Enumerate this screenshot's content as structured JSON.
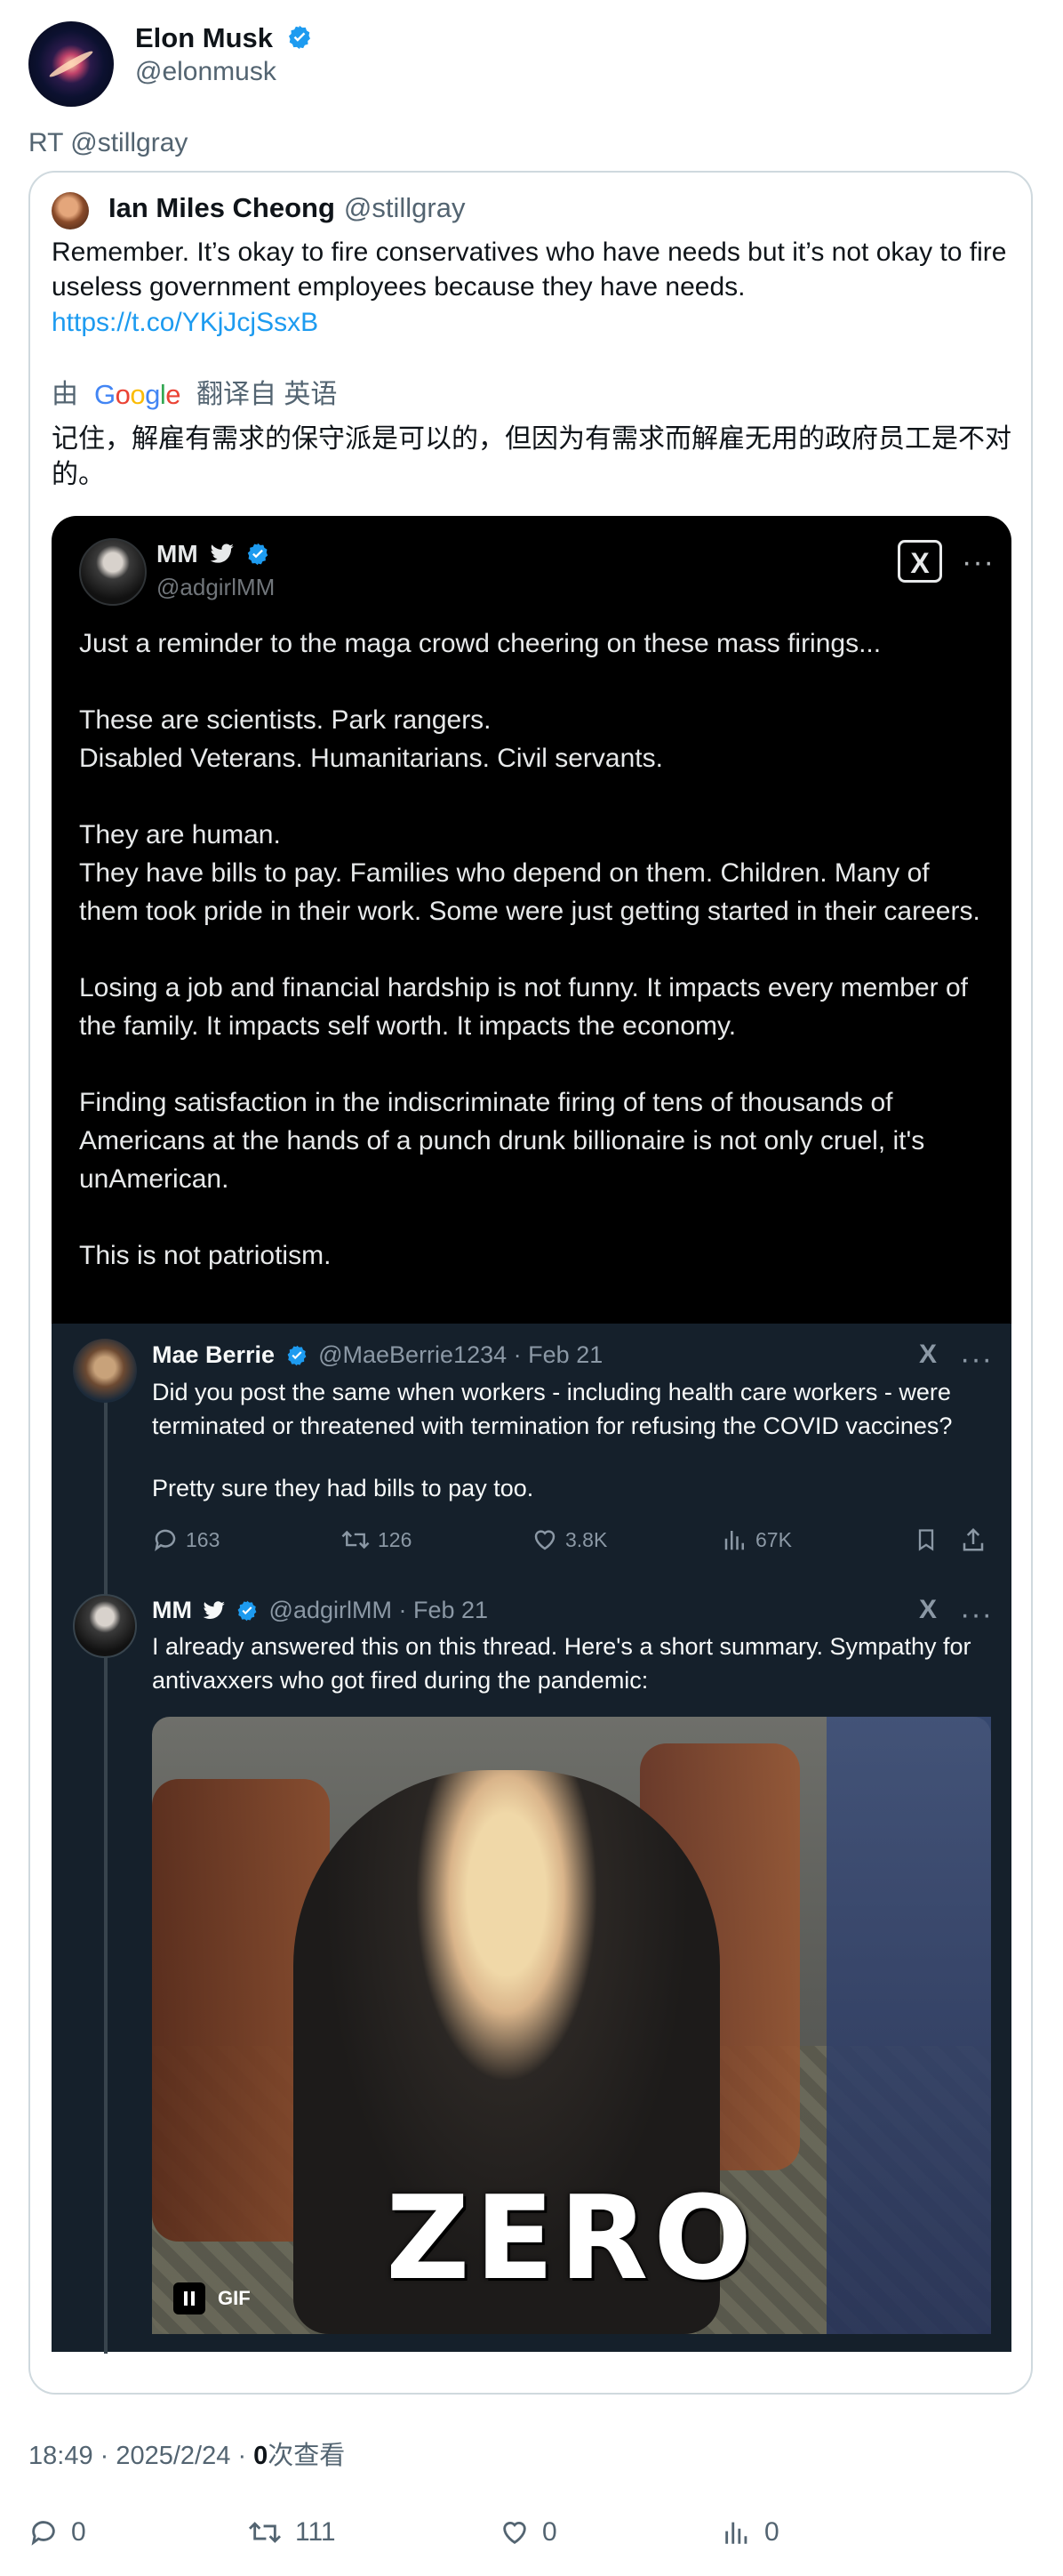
{
  "author": {
    "name": "Elon Musk",
    "handle": "@elonmusk"
  },
  "retweet_label": "RT @stillgray",
  "quoted": {
    "name": "Ian Miles Cheong",
    "handle": "@stillgray",
    "text": "Remember. It’s okay to fire conservatives who have needs but it’s not okay to fire useless government employees because they have needs.",
    "link": "https://t.co/YKjJcjSsxB",
    "translate": {
      "prefix": "由",
      "brand": "Google",
      "suffix": "翻译自 英语",
      "text": "记住，解雇有需求的保守派是可以的，但因为有需求而解雇无用的政府员工是不对的。"
    }
  },
  "embedded": {
    "name": "MM",
    "handle": "@adgirlMM",
    "paragraphs": [
      "Just a reminder to the maga crowd cheering on these mass firings...",
      "These are scientists. Park rangers.\nDisabled Veterans. Humanitarians. Civil servants.",
      "They are human.\nThey have bills to pay. Families who depend on them. Children. Many of them took pride in their work. Some were just getting started in their careers.",
      "Losing a job and financial hardship is not funny.  It impacts every member of the family. It impacts self worth. It impacts the economy.",
      "Finding satisfaction in the indiscriminate firing of tens of thousands of Americans at the hands of a punch drunk billionaire is not only cruel, it's unAmerican.",
      "This is not patriotism."
    ],
    "replies": [
      {
        "name": "Mae Berrie",
        "handle": "@MaeBerrie1234",
        "date": "Feb 21",
        "text1": "Did you post the same when workers - including health care workers - were terminated or threatened with termination for refusing the COVID vaccines?",
        "text2": "Pretty sure they had bills to pay too.",
        "replies": "163",
        "reposts": "126",
        "likes": "3.8K",
        "views": "67K"
      },
      {
        "name": "MM",
        "handle": "@adgirlMM",
        "date": "Feb 21",
        "text1": "I already answered this on this thread. Here's a short summary. Sympathy for antivaxxers who got fired during the pandemic:",
        "gif_caption": "ZERO",
        "gif_label": "GIF"
      }
    ]
  },
  "meta": {
    "time": "18:49",
    "date": "2025/2/24",
    "views_count": "0",
    "views_label": "次查看"
  },
  "stats": {
    "replies": "0",
    "reposts": "111",
    "likes": "0",
    "views": "0"
  },
  "colors": {
    "accent": "#1d9bf0",
    "secondary_text": "#536471",
    "border": "#cfd9de"
  }
}
